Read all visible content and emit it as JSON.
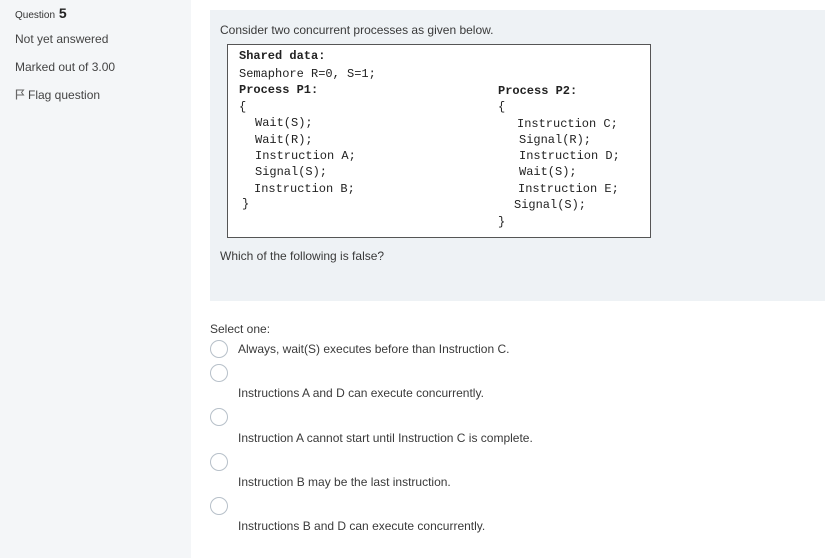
{
  "sidebar": {
    "question_prefix": "Question",
    "question_number": "5",
    "state": "Not yet answered",
    "marked_out_of": "Marked out of 3.00",
    "flag_label": "Flag question"
  },
  "question": {
    "intro": "Consider two concurrent processes as given below.",
    "code": {
      "shared_data": "Shared data:",
      "semaphore": "Semaphore R=0, S=1;",
      "p1_header": "Process P1:",
      "p1_open": "{",
      "p1_lines": [
        "Wait(S);",
        "Wait(R);",
        "Instruction A;",
        "Signal(S);",
        "Instruction B;"
      ],
      "p1_close": "}",
      "p2_header": "Process P2:",
      "p2_open": "{",
      "p2_lines": [
        "Instruction C;",
        "Signal(R);",
        "Instruction D;",
        "Wait(S);",
        "Instruction E;",
        "Signal(S);"
      ],
      "p2_close": "}"
    },
    "prompt": "Which of the following  is false?"
  },
  "answer": {
    "select_label": "Select one:",
    "options": [
      "Always, wait(S) executes before than Instruction C.",
      "Instructions A and D can execute concurrently.",
      "Instruction A cannot start until Instruction C is complete.",
      "Instruction B may be the last instruction.",
      "Instructions B  and  D  can execute concurrently."
    ]
  }
}
